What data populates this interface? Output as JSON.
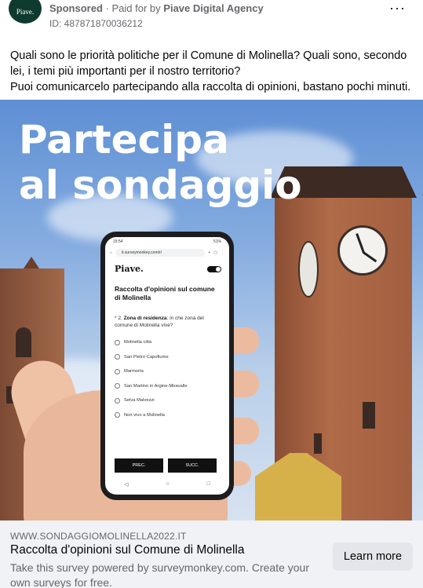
{
  "header": {
    "avatar_text": "Piave.",
    "sponsored": "Sponsored",
    "separator": "·",
    "paid_for_by": "Paid for by",
    "agency": "Piave Digital Agency",
    "ad_id": "ID: 487871870036212",
    "more": "···"
  },
  "post": {
    "line1": "Quali sono le priorità politiche per il Comune di Molinella? Quali sono, secondo lei, i temi più importanti per il nostro territorio?",
    "line2": "Puoi comunicarcelo partecipando alla raccolta di opinioni, bastano pochi minuti."
  },
  "creative": {
    "headline_1": "Partecipa",
    "headline_2": "al sondaggio",
    "phone": {
      "time": "15:54",
      "battery": "51%",
      "url": "it.surveymonkey.com/r/",
      "brand": "Piave.",
      "survey_title": "Raccolta d'opinioni sul comune di Molinella",
      "question_number": "* 2.",
      "question_bold": "Zona di residenza",
      "question_rest": ": in che zona del comune di Molinella vive?",
      "options": [
        "Molinella città",
        "San Pietro Capofiume",
        "Marmorta",
        "San Martino in Argine-Miravalle",
        "Selva Malvezzi",
        "Non vivo a Molinella"
      ],
      "prev": "PREC.",
      "next": "SUCC."
    }
  },
  "footer": {
    "domain": "WWW.SONDAGGIOMOLINELLA2022.IT",
    "title": "Raccolta d'opinioni sul Comune di Molinella",
    "description": "Take this survey powered by surveymonkey.com. Create your own surveys for free.",
    "cta": "Learn more"
  }
}
